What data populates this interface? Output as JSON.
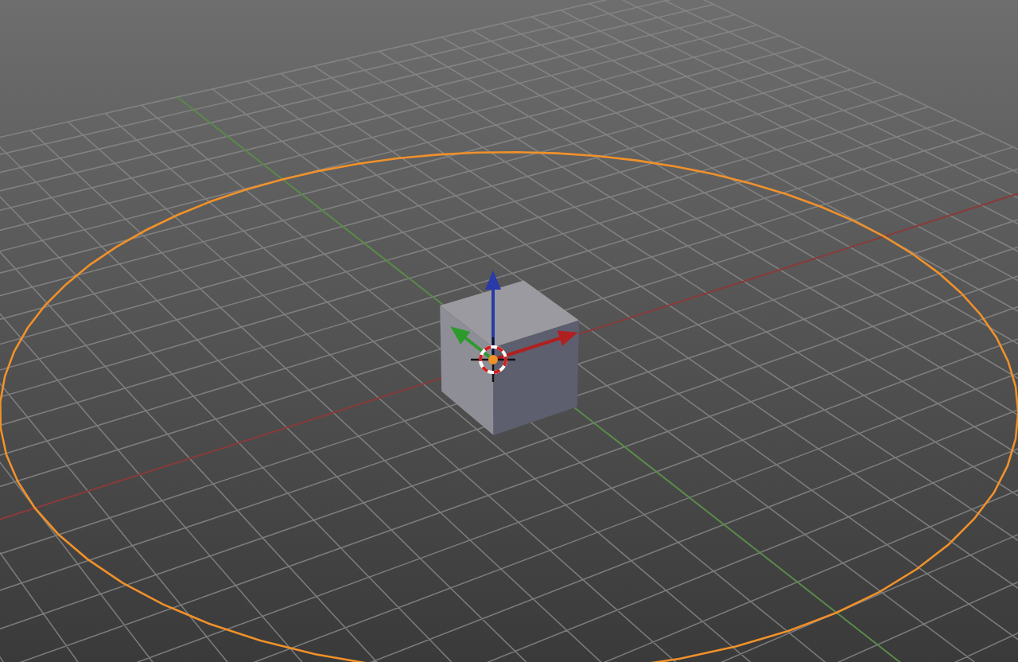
{
  "objects": [
    {
      "kind": "circle",
      "selected": true
    },
    {
      "kind": "cube",
      "selected": false
    }
  ]
}
